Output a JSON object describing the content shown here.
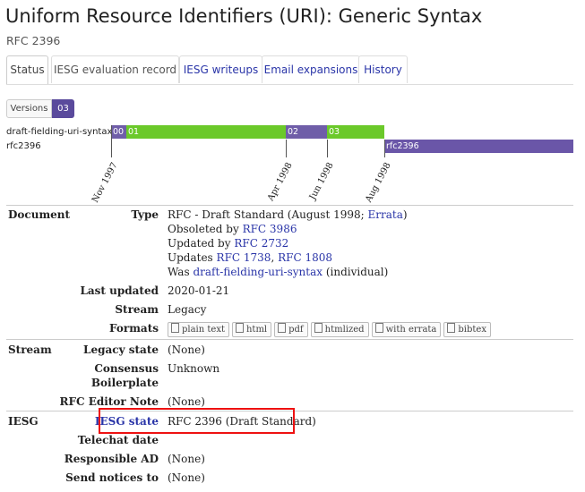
{
  "page": {
    "title": "Uniform Resource Identifiers (URI): Generic Syntax",
    "subtitle": "RFC 2396"
  },
  "tabs": [
    {
      "label": "Status",
      "active": true
    },
    {
      "label": "IESG evaluation record",
      "active": false
    },
    {
      "label": "IESG writeups",
      "active": false
    },
    {
      "label": "Email expansions",
      "active": false
    },
    {
      "label": "History",
      "active": false
    }
  ],
  "versions": {
    "label": "Versions",
    "selected": "03"
  },
  "timeline": {
    "rows": [
      {
        "name": "draft-fielding-uri-syntax",
        "segments": [
          "00",
          "01",
          "02",
          "03"
        ]
      },
      {
        "name": "rfc2396",
        "segments": [
          "rfc2396"
        ]
      }
    ],
    "dates": [
      "Nov 1997",
      "Apr 1998",
      "Jun 1998",
      "Aug 1998"
    ],
    "colors": {
      "draft_purple": "#6f5ea8",
      "draft_green": "#6bc92a",
      "rfc": "#6a56a8"
    }
  },
  "document": {
    "section": "Document",
    "type_key": "Type",
    "type_prefix": "RFC - Draft Standard (August 1998;",
    "type_errata": "Errata",
    "type_suffix": ")",
    "obsoleted_prefix": "Obsoleted by",
    "obsoleted_link": "RFC 3986",
    "updated_prefix": "Updated by",
    "updated_link": "RFC 2732",
    "updates_prefix": "Updates",
    "updates_link1": "RFC 1738",
    "updates_sep": ",",
    "updates_link2": "RFC 1808",
    "was_prefix": "Was",
    "was_link": "draft-fielding-uri-syntax",
    "was_suffix": "(individual)",
    "last_updated_key": "Last updated",
    "last_updated": "2020-01-21",
    "stream_key": "Stream",
    "stream": "Legacy",
    "formats_key": "Formats",
    "formats": [
      "plain text",
      "html",
      "pdf",
      "htmlized",
      "with errata",
      "bibtex"
    ]
  },
  "stream_section": {
    "section": "Stream",
    "legacy_state_key": "Legacy state",
    "legacy_state": "(None)",
    "consensus_key_1": "Consensus",
    "consensus_key_2": "Boilerplate",
    "consensus": "Unknown",
    "rfc_editor_note_key": "RFC Editor Note",
    "rfc_editor_note": "(None)"
  },
  "iesg_section": {
    "section": "IESG",
    "iesg_state_key": "IESG state",
    "iesg_state": "RFC 2396 (Draft Standard)",
    "telechat_key": "Telechat date",
    "telechat": "",
    "responsible_ad_key": "Responsible AD",
    "responsible_ad": "(None)",
    "send_notices_key": "Send notices to",
    "send_notices": "(None)"
  },
  "highlight_color": "#e11111"
}
